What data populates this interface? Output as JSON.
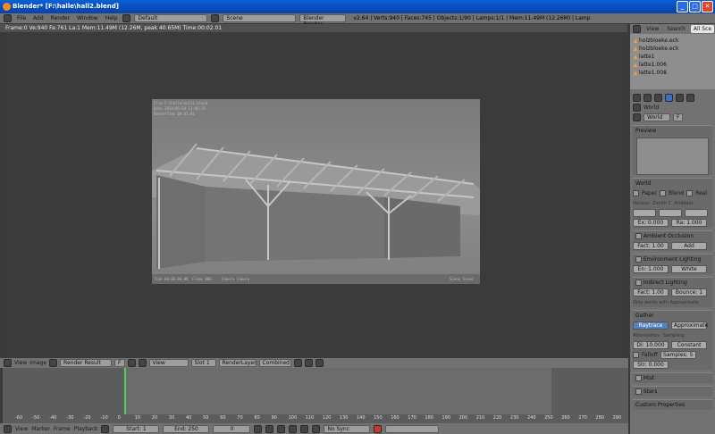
{
  "window": {
    "title": "Blender* [F:\\halle\\hall2.blend]"
  },
  "menubar": {
    "items": [
      "File",
      "Add",
      "Render",
      "Window",
      "Help"
    ],
    "layout": "Default",
    "scene": "Scene",
    "engine": "Blender Render",
    "stats": "v2.64 | Verts:940 | Faces:745 | Objects:1/90 | Lamps:1/1 | Mem:11.49M (12.26M) | Lamp"
  },
  "viewport": {
    "header": "Frame:0 Ve:940 Fa:761 La:1 Mem:11.49M (12.26M, peak 40.65M) Time:00:02.01",
    "stamps": {
      "file": "File F:\\halle\\hall2.blend",
      "date": "Date 2014/05/24 11:06:28",
      "rendertime": "RenderTime 00:02.01",
      "time": "Time 00:00:00:00",
      "frame": "Frame 000",
      "camera": "Camera Camera",
      "scene": "Scene Scene"
    }
  },
  "image_editor": {
    "view": "View",
    "image": "Image",
    "result": "Render Result",
    "f": "F",
    "view_menu": "View",
    "slot": "Slot 1",
    "layer": "RenderLayer",
    "pass": "Combined"
  },
  "timeline": {
    "ticks": [
      "-60",
      "-50",
      "-40",
      "-30",
      "-20",
      "-10",
      "0",
      "10",
      "20",
      "30",
      "40",
      "50",
      "60",
      "70",
      "80",
      "90",
      "100",
      "110",
      "120",
      "130",
      "140",
      "150",
      "160",
      "170",
      "180",
      "190",
      "200",
      "210",
      "220",
      "230",
      "240",
      "250",
      "260",
      "270",
      "280",
      "290"
    ],
    "menus": [
      "View",
      "Marker",
      "Frame",
      "Playback"
    ],
    "start": "Start: 1",
    "end": "End: 250",
    "current": "0",
    "sync": "No Sync"
  },
  "outliner": {
    "tabs": [
      "View",
      "Search",
      "All Sce"
    ],
    "items": [
      "holzbloeke.eck",
      "holzbloeke.eck",
      "latte1",
      "latte1.006",
      "latte1.008"
    ]
  },
  "properties": {
    "world_path": "World",
    "world_name": "World",
    "world_f": "F",
    "preview": "Preview",
    "world_panel": {
      "title": "World",
      "paper": "Paper",
      "blend": "Blend",
      "real": "Real",
      "horizon": "Horizon",
      "zenith": "Zenith C",
      "ambient": "Ambient",
      "exposure": "Ex: 0.000",
      "range": "Ra: 1.000"
    },
    "ao": {
      "title": "Ambient Occlusion",
      "factor": "Fact: 1.00",
      "mode": "Add"
    },
    "env": {
      "title": "Environment Lighting",
      "energy": "En: 1.000",
      "color": "White"
    },
    "indirect": {
      "title": "Indirect Lighting",
      "factor": "Fact: 1.00",
      "bounces": "Bounce: 1",
      "note": "Only works with Approximate"
    },
    "gather": {
      "title": "Gather",
      "raytrace": "Raytrace",
      "approximate": "Approximate",
      "attenuation": "Attenuation:",
      "sampling": "Sampling:",
      "distance": "Di: 10.000",
      "constant": "Constant",
      "falloff": "Falloff",
      "samples": "Samples: 5",
      "strength": "Str: 0.000"
    },
    "mist": "Mist",
    "stars": "Stars",
    "custom": "Custom Properties"
  }
}
